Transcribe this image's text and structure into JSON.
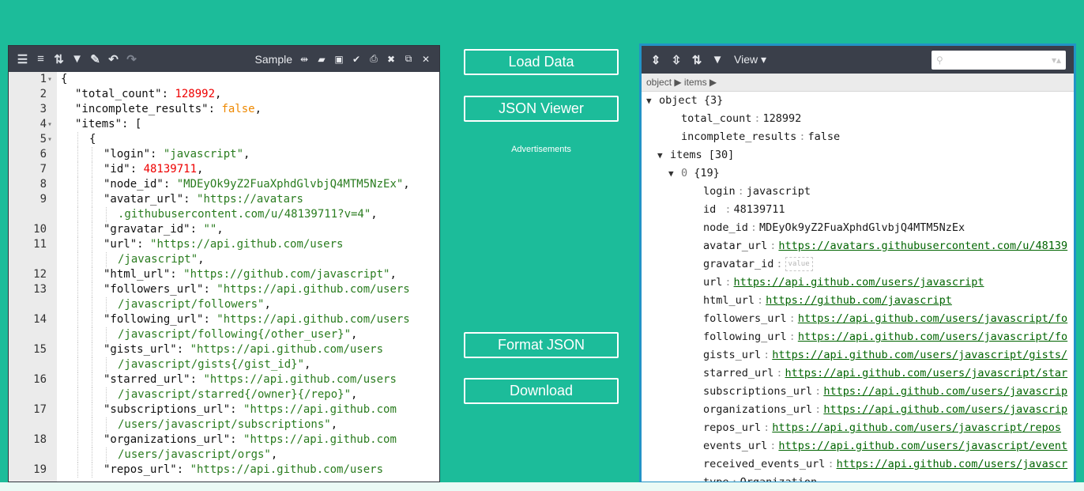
{
  "editor": {
    "toolbar": {
      "icons": [
        "format-icon",
        "compact-icon",
        "sort-icon",
        "filter-icon",
        "repair-icon",
        "undo-icon",
        "redo-icon"
      ],
      "sample_label": "Sample",
      "right_icons": [
        "move-icon",
        "open-folder-icon",
        "save-icon",
        "check-icon",
        "print-icon",
        "close-icon",
        "copy-icon",
        "expand-icon"
      ]
    },
    "lines": [
      {
        "no": "1",
        "fold": "▾",
        "indent": 0,
        "parts": [
          [
            "p",
            "{"
          ]
        ]
      },
      {
        "no": "2",
        "fold": "",
        "indent": 1,
        "parts": [
          [
            "k",
            "\"total_count\""
          ],
          [
            "p",
            ": "
          ],
          [
            "n",
            "128992"
          ],
          [
            "p",
            ","
          ]
        ]
      },
      {
        "no": "3",
        "fold": "",
        "indent": 1,
        "parts": [
          [
            "k",
            "\"incomplete_results\""
          ],
          [
            "p",
            ": "
          ],
          [
            "b",
            "false"
          ],
          [
            "p",
            ","
          ]
        ]
      },
      {
        "no": "4",
        "fold": "▾",
        "indent": 1,
        "parts": [
          [
            "k",
            "\"items\""
          ],
          [
            "p",
            ": ["
          ]
        ]
      },
      {
        "no": "5",
        "fold": "▾",
        "indent": 2,
        "parts": [
          [
            "p",
            "{"
          ]
        ]
      },
      {
        "no": "6",
        "fold": "",
        "indent": 3,
        "parts": [
          [
            "k",
            "\"login\""
          ],
          [
            "p",
            ": "
          ],
          [
            "s",
            "\"javascript\""
          ],
          [
            "p",
            ","
          ]
        ]
      },
      {
        "no": "7",
        "fold": "",
        "indent": 3,
        "parts": [
          [
            "k",
            "\"id\""
          ],
          [
            "p",
            ": "
          ],
          [
            "n",
            "48139711"
          ],
          [
            "p",
            ","
          ]
        ]
      },
      {
        "no": "8",
        "fold": "",
        "indent": 3,
        "parts": [
          [
            "k",
            "\"node_id\""
          ],
          [
            "p",
            ": "
          ],
          [
            "s",
            "\"MDEyOk9yZ2FuaXphdGlvbjQ4MTM5NzEx\""
          ],
          [
            "p",
            ","
          ]
        ]
      },
      {
        "no": "9",
        "fold": "",
        "indent": 3,
        "parts": [
          [
            "k",
            "\"avatar_url\""
          ],
          [
            "p",
            ": "
          ],
          [
            "s",
            "\"https://avatars"
          ]
        ]
      },
      {
        "no": "",
        "fold": "",
        "indent": 4,
        "parts": [
          [
            "s",
            ".githubusercontent.com/u/48139711?v=4\""
          ],
          [
            "p",
            ","
          ]
        ]
      },
      {
        "no": "10",
        "fold": "",
        "indent": 3,
        "parts": [
          [
            "k",
            "\"gravatar_id\""
          ],
          [
            "p",
            ": "
          ],
          [
            "s",
            "\"\""
          ],
          [
            "p",
            ","
          ]
        ]
      },
      {
        "no": "11",
        "fold": "",
        "indent": 3,
        "parts": [
          [
            "k",
            "\"url\""
          ],
          [
            "p",
            ": "
          ],
          [
            "s",
            "\"https://api.github.com/users"
          ]
        ]
      },
      {
        "no": "",
        "fold": "",
        "indent": 4,
        "parts": [
          [
            "s",
            "/javascript\""
          ],
          [
            "p",
            ","
          ]
        ]
      },
      {
        "no": "12",
        "fold": "",
        "indent": 3,
        "parts": [
          [
            "k",
            "\"html_url\""
          ],
          [
            "p",
            ": "
          ],
          [
            "s",
            "\"https://github.com/javascript\""
          ],
          [
            "p",
            ","
          ]
        ]
      },
      {
        "no": "13",
        "fold": "",
        "indent": 3,
        "parts": [
          [
            "k",
            "\"followers_url\""
          ],
          [
            "p",
            ": "
          ],
          [
            "s",
            "\"https://api.github.com/users"
          ]
        ]
      },
      {
        "no": "",
        "fold": "",
        "indent": 4,
        "parts": [
          [
            "s",
            "/javascript/followers\""
          ],
          [
            "p",
            ","
          ]
        ]
      },
      {
        "no": "14",
        "fold": "",
        "indent": 3,
        "parts": [
          [
            "k",
            "\"following_url\""
          ],
          [
            "p",
            ": "
          ],
          [
            "s",
            "\"https://api.github.com/users"
          ]
        ]
      },
      {
        "no": "",
        "fold": "",
        "indent": 4,
        "parts": [
          [
            "s",
            "/javascript/following{/other_user}\""
          ],
          [
            "p",
            ","
          ]
        ]
      },
      {
        "no": "15",
        "fold": "",
        "indent": 3,
        "parts": [
          [
            "k",
            "\"gists_url\""
          ],
          [
            "p",
            ": "
          ],
          [
            "s",
            "\"https://api.github.com/users"
          ]
        ]
      },
      {
        "no": "",
        "fold": "",
        "indent": 4,
        "parts": [
          [
            "s",
            "/javascript/gists{/gist_id}\""
          ],
          [
            "p",
            ","
          ]
        ]
      },
      {
        "no": "16",
        "fold": "",
        "indent": 3,
        "parts": [
          [
            "k",
            "\"starred_url\""
          ],
          [
            "p",
            ": "
          ],
          [
            "s",
            "\"https://api.github.com/users"
          ]
        ]
      },
      {
        "no": "",
        "fold": "",
        "indent": 4,
        "parts": [
          [
            "s",
            "/javascript/starred{/owner}{/repo}\""
          ],
          [
            "p",
            ","
          ]
        ]
      },
      {
        "no": "17",
        "fold": "",
        "indent": 3,
        "parts": [
          [
            "k",
            "\"subscriptions_url\""
          ],
          [
            "p",
            ": "
          ],
          [
            "s",
            "\"https://api.github.com"
          ]
        ]
      },
      {
        "no": "",
        "fold": "",
        "indent": 4,
        "parts": [
          [
            "s",
            "/users/javascript/subscriptions\""
          ],
          [
            "p",
            ","
          ]
        ]
      },
      {
        "no": "18",
        "fold": "",
        "indent": 3,
        "parts": [
          [
            "k",
            "\"organizations_url\""
          ],
          [
            "p",
            ": "
          ],
          [
            "s",
            "\"https://api.github.com"
          ]
        ]
      },
      {
        "no": "",
        "fold": "",
        "indent": 4,
        "parts": [
          [
            "s",
            "/users/javascript/orgs\""
          ],
          [
            "p",
            ","
          ]
        ]
      },
      {
        "no": "19",
        "fold": "",
        "indent": 3,
        "parts": [
          [
            "k",
            "\"repos_url\""
          ],
          [
            "p",
            ": "
          ],
          [
            "s",
            "\"https://api.github.com/users"
          ]
        ]
      }
    ]
  },
  "middle": {
    "load_label": "Load Data",
    "viewer_label": "JSON Viewer",
    "ads_label": "Advertisements",
    "format_label": "Format JSON",
    "download_label": "Download"
  },
  "viewer": {
    "toolbar": {
      "icons": [
        "expand-all-icon",
        "collapse-all-icon",
        "sort-icon",
        "filter-icon"
      ],
      "view_label": "View ▾",
      "search_placeholder": ""
    },
    "breadcrumb": "object ▶ items ▶",
    "rows": [
      {
        "indent": 0,
        "arrow": "▼",
        "key": "object",
        "sep": "",
        "value": "{3}",
        "kind": "plain"
      },
      {
        "indent": 2,
        "arrow": "",
        "key": "total_count",
        "sep": ":",
        "value": "128992",
        "kind": "plain"
      },
      {
        "indent": 2,
        "arrow": "",
        "key": "incomplete_results",
        "sep": ":",
        "value": "false",
        "kind": "plain"
      },
      {
        "indent": 1,
        "arrow": "▼",
        "key": "items",
        "sep": "",
        "value": "[30]",
        "kind": "plain"
      },
      {
        "indent": 2,
        "arrow": "▼",
        "key": "0",
        "sep": "",
        "value": "{19}",
        "kind": "index"
      },
      {
        "indent": 4,
        "arrow": "",
        "key": "login",
        "sep": ":",
        "value": "javascript",
        "kind": "plain"
      },
      {
        "indent": 4,
        "arrow": "",
        "key": "id",
        "sep": " :",
        "value": "48139711",
        "kind": "plain"
      },
      {
        "indent": 4,
        "arrow": "",
        "key": "node_id",
        "sep": ":",
        "value": "MDEyOk9yZ2FuaXphdGlvbjQ4MTM5NzEx",
        "kind": "plain"
      },
      {
        "indent": 4,
        "arrow": "",
        "key": "avatar_url",
        "sep": ":",
        "value": "https://avatars.githubusercontent.com/u/48139",
        "kind": "link"
      },
      {
        "indent": 4,
        "arrow": "",
        "key": "gravatar_id",
        "sep": ":",
        "value": "value",
        "kind": "empty"
      },
      {
        "indent": 4,
        "arrow": "",
        "key": "url",
        "sep": ":",
        "value": "https://api.github.com/users/javascript",
        "kind": "link"
      },
      {
        "indent": 4,
        "arrow": "",
        "key": "html_url",
        "sep": ":",
        "value": "https://github.com/javascript",
        "kind": "link"
      },
      {
        "indent": 4,
        "arrow": "",
        "key": "followers_url",
        "sep": ":",
        "value": "https://api.github.com/users/javascript/fo",
        "kind": "link"
      },
      {
        "indent": 4,
        "arrow": "",
        "key": "following_url",
        "sep": ":",
        "value": "https://api.github.com/users/javascript/fo",
        "kind": "link"
      },
      {
        "indent": 4,
        "arrow": "",
        "key": "gists_url",
        "sep": ":",
        "value": "https://api.github.com/users/javascript/gists/",
        "kind": "link"
      },
      {
        "indent": 4,
        "arrow": "",
        "key": "starred_url",
        "sep": ":",
        "value": "https://api.github.com/users/javascript/star",
        "kind": "link"
      },
      {
        "indent": 4,
        "arrow": "",
        "key": "subscriptions_url",
        "sep": ":",
        "value": "https://api.github.com/users/javascrip",
        "kind": "link"
      },
      {
        "indent": 4,
        "arrow": "",
        "key": "organizations_url",
        "sep": ":",
        "value": "https://api.github.com/users/javascrip",
        "kind": "link"
      },
      {
        "indent": 4,
        "arrow": "",
        "key": "repos_url",
        "sep": ":",
        "value": "https://api.github.com/users/javascript/repos",
        "kind": "link"
      },
      {
        "indent": 4,
        "arrow": "",
        "key": "events_url",
        "sep": ":",
        "value": "https://api.github.com/users/javascript/event",
        "kind": "link"
      },
      {
        "indent": 4,
        "arrow": "",
        "key": "received_events_url",
        "sep": ":",
        "value": "https://api.github.com/users/javascr",
        "kind": "link"
      },
      {
        "indent": 4,
        "arrow": "",
        "key": "type",
        "sep": ":",
        "value": "Organization",
        "kind": "plain"
      }
    ]
  },
  "colors": {
    "background": "#1cbc9a",
    "toolbar": "#3a3f4a",
    "viewer_border": "#2293c6",
    "string": "#2a7c1f",
    "number": "#ee0000",
    "boolean": "#ee8800"
  }
}
